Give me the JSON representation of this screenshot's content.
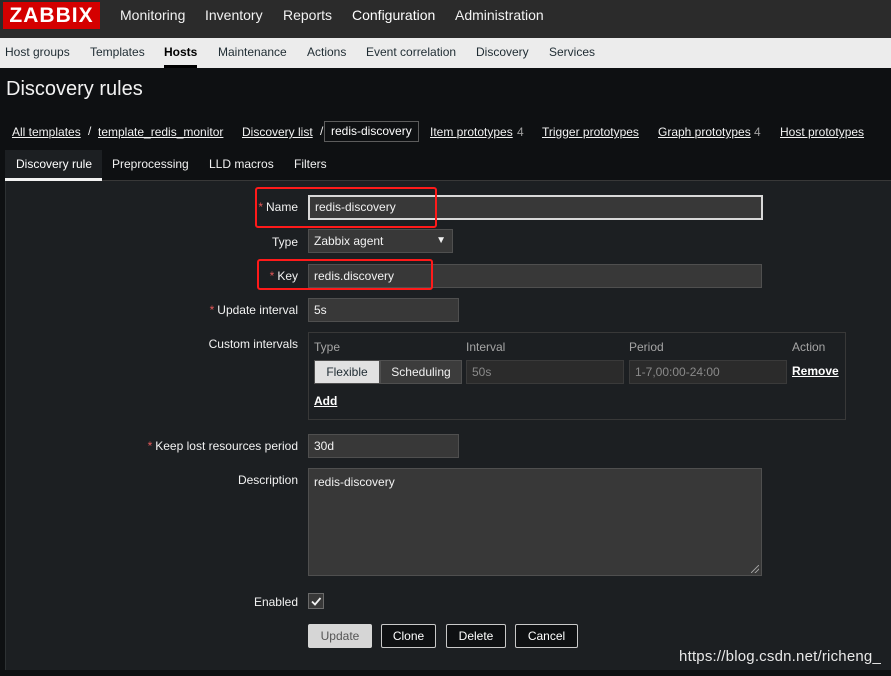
{
  "app": {
    "logo": "ZABBIX"
  },
  "top_nav": [
    "Monitoring",
    "Inventory",
    "Reports",
    "Configuration",
    "Administration"
  ],
  "sub_nav": [
    "Host groups",
    "Templates",
    "Hosts",
    "Maintenance",
    "Actions",
    "Event correlation",
    "Discovery",
    "Services"
  ],
  "page": {
    "title": "Discovery rules"
  },
  "breadcrumb": {
    "all_templates": "All templates",
    "sep": "/",
    "template": "template_redis_monitor",
    "discovery_list": "Discovery list",
    "current": "redis-discovery",
    "item_prototypes": "Item prototypes",
    "item_prototypes_count": "4",
    "trigger_prototypes": "Trigger prototypes",
    "graph_prototypes": "Graph prototypes",
    "graph_prototypes_count": "4",
    "host_prototypes": "Host prototypes"
  },
  "tabs": [
    "Discovery rule",
    "Preprocessing",
    "LLD macros",
    "Filters"
  ],
  "form": {
    "required_mark": "*",
    "name_label": "Name",
    "name_value": "redis-discovery",
    "type_label": "Type",
    "type_value": "Zabbix agent",
    "type_arrow": "▼",
    "key_label": "Key",
    "key_value": "redis.discovery",
    "update_interval_label": "Update interval",
    "update_interval_value": "5s",
    "custom_intervals_label": "Custom intervals",
    "ci_col_type": "Type",
    "ci_col_interval": "Interval",
    "ci_col_period": "Period",
    "ci_col_action": "Action",
    "ci_flexible": "Flexible",
    "ci_scheduling": "Scheduling",
    "ci_interval_value": "50s",
    "ci_period_value": "1-7,00:00-24:00",
    "ci_remove": "Remove",
    "ci_add": "Add",
    "keep_lost_label": "Keep lost resources period",
    "keep_lost_value": "30d",
    "description_label": "Description",
    "description_value": "redis-discovery",
    "enabled_label": "Enabled",
    "enabled": true
  },
  "buttons": {
    "update": "Update",
    "clone": "Clone",
    "delete": "Delete",
    "cancel": "Cancel"
  },
  "watermark": "https://blog.csdn.net/richeng_",
  "colors": {
    "logo_red": "#d40000",
    "highlight_red": "#ff1a1a",
    "required_red": "#e45959"
  }
}
